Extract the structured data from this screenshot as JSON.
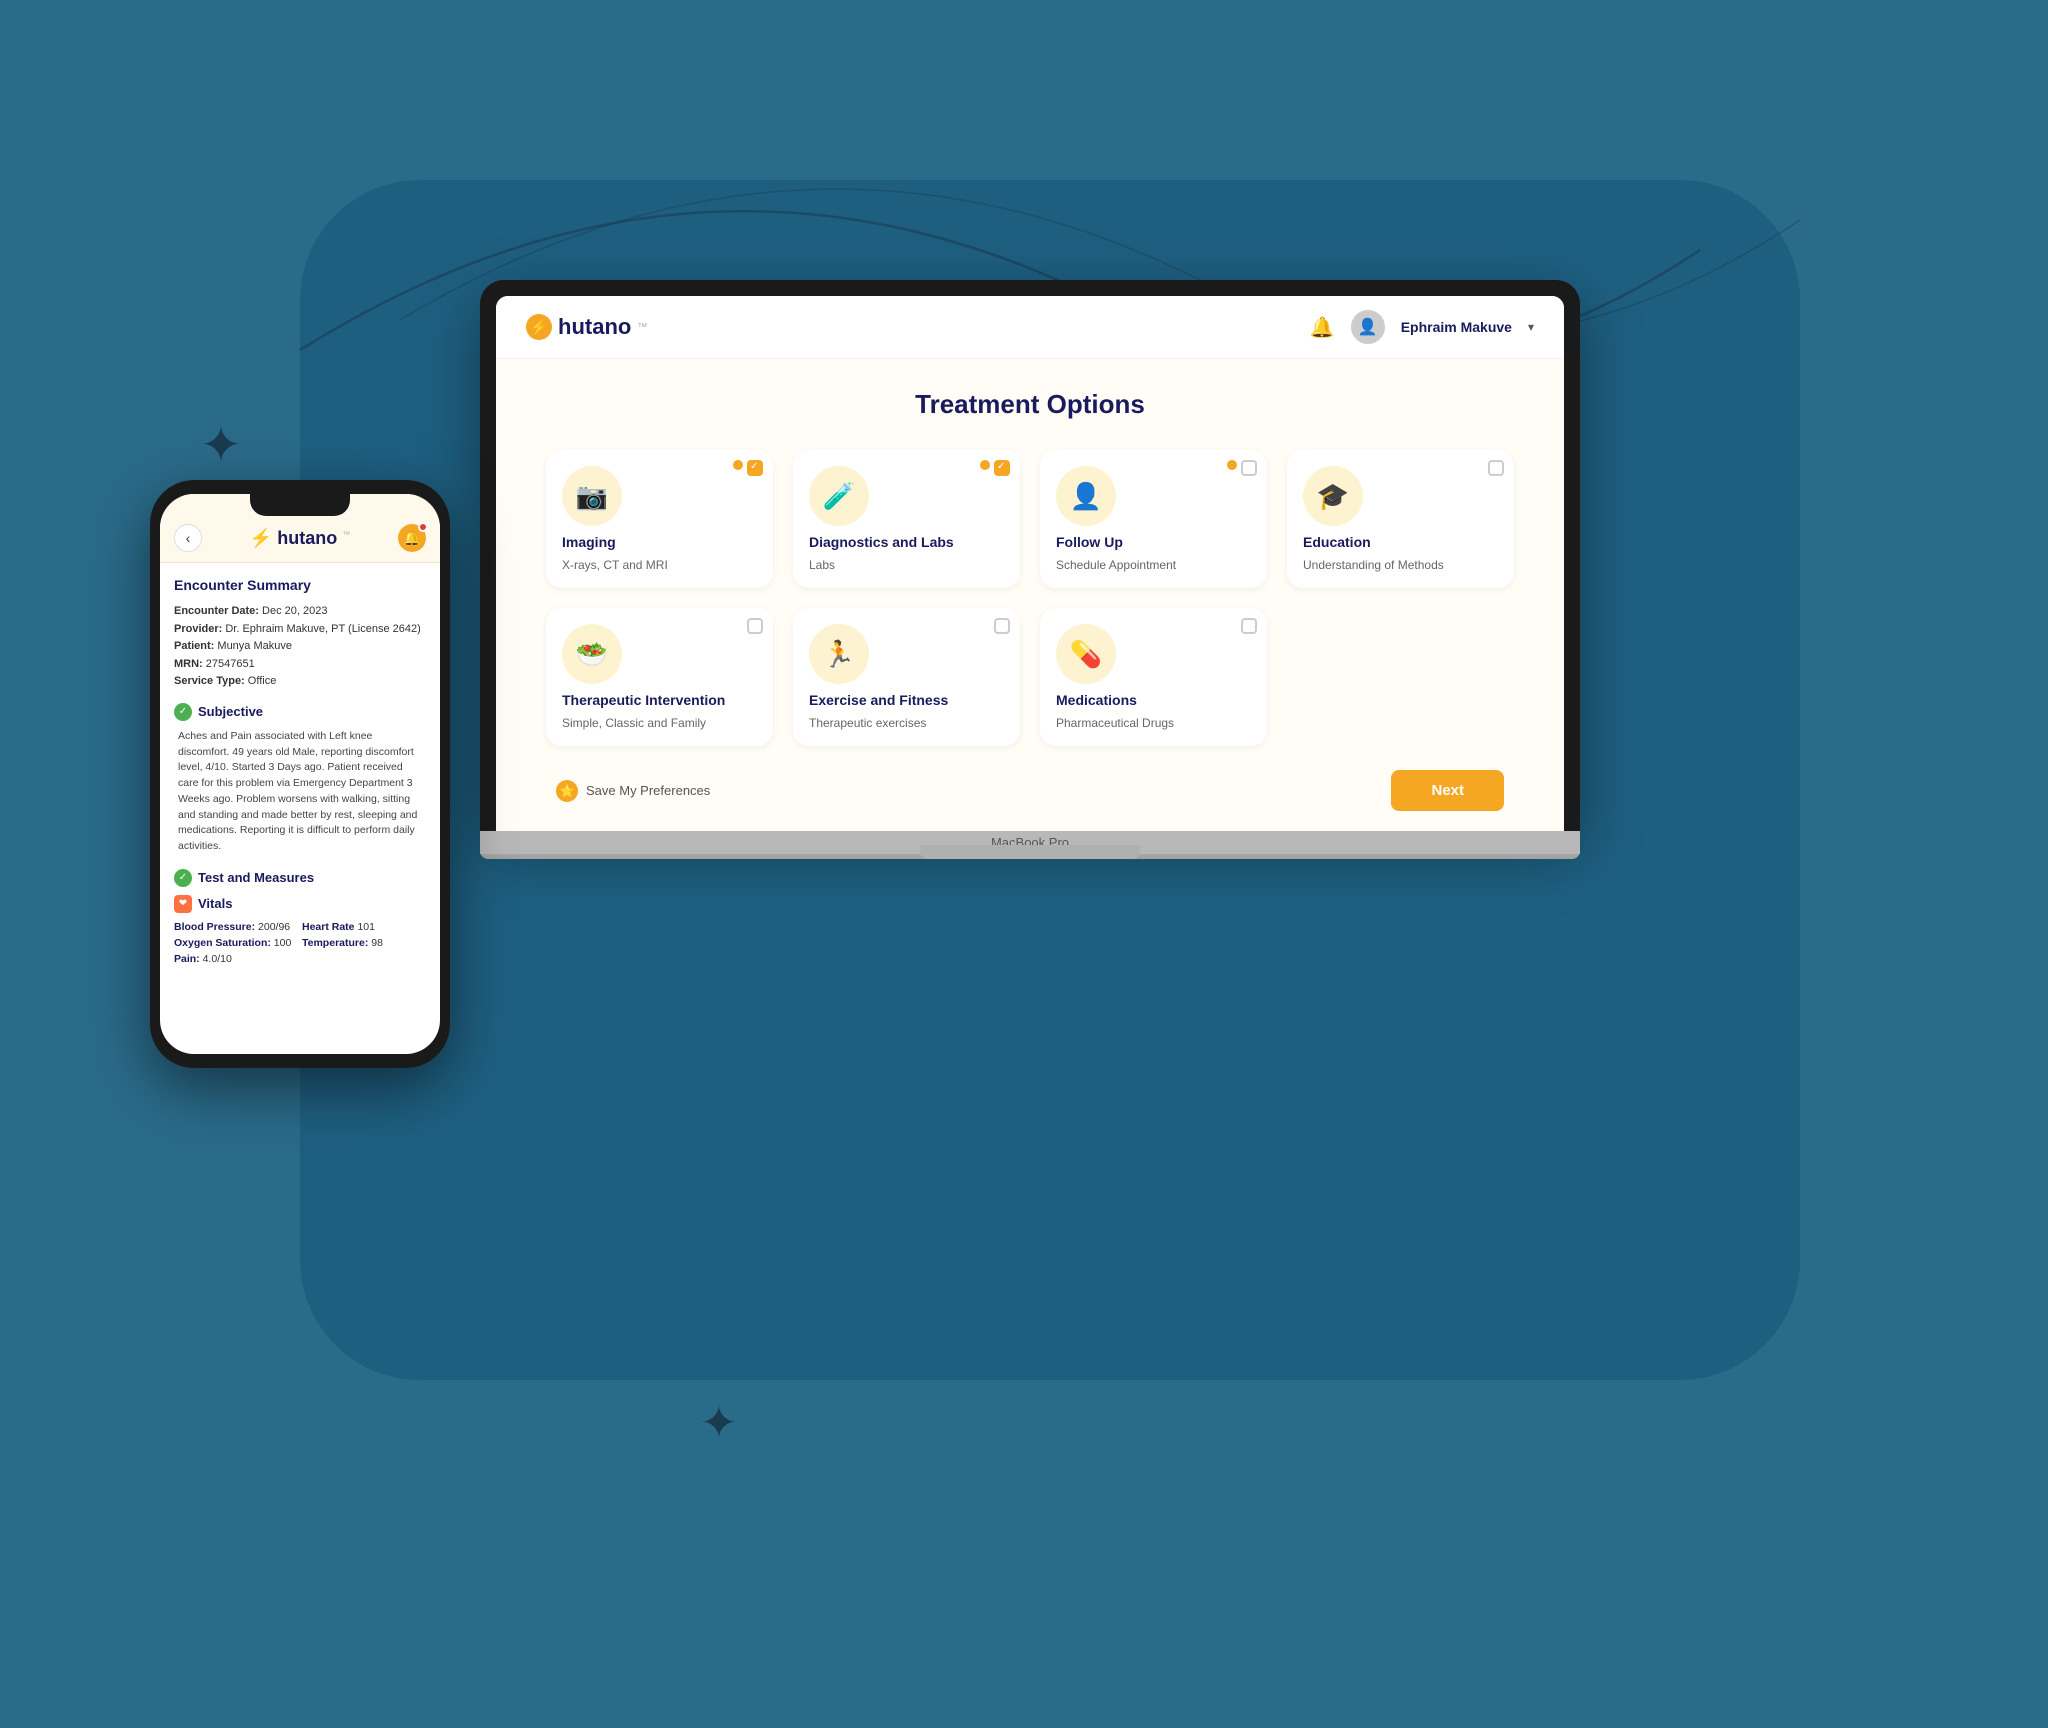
{
  "page": {
    "background_color": "#2a6b8a",
    "blob_color": "#1e5f80"
  },
  "laptop": {
    "model_label": "MacBook Pro",
    "header": {
      "logo_text": "hutano",
      "logo_symbol": "⚡",
      "notification_icon": "🔔",
      "user_name": "Ephraim Makuve",
      "chevron": "▾"
    },
    "content": {
      "title": "Treatment Options",
      "cards": [
        {
          "id": "imaging",
          "icon": "📷",
          "title": "Imaging",
          "subtitle": "X-rays, CT and MRI",
          "checked": true,
          "has_dot": true
        },
        {
          "id": "diagnostics",
          "icon": "🧪",
          "title": "Diagnostics and Labs",
          "subtitle": "Labs",
          "checked": true,
          "has_dot": true
        },
        {
          "id": "followup",
          "icon": "👤",
          "title": "Follow Up",
          "subtitle": "Schedule Appointment",
          "checked": false,
          "has_dot": true
        },
        {
          "id": "education",
          "icon": "🎓",
          "title": "Education",
          "subtitle": "Understanding of Methods",
          "checked": false,
          "has_dot": false
        },
        {
          "id": "therapeutic",
          "icon": "🥗",
          "title": "Therapeutic Intervention",
          "subtitle": "Simple, Classic and Family",
          "checked": false,
          "has_dot": false
        },
        {
          "id": "exercise",
          "icon": "🏃",
          "title": "Exercise and Fitness",
          "subtitle": "Therapeutic exercises",
          "checked": false,
          "has_dot": false
        },
        {
          "id": "medications",
          "icon": "💊",
          "title": "Medications",
          "subtitle": "Pharmaceutical Drugs",
          "checked": false,
          "has_dot": false
        }
      ],
      "save_preferences_label": "Save My Preferences",
      "next_button_label": "Next"
    }
  },
  "phone": {
    "back_icon": "‹",
    "logo_text": "hutano",
    "logo_symbol": "⚡",
    "notification_count": "1",
    "sections": {
      "encounter_summary": {
        "title": "Encounter Summary",
        "encounter_date_label": "Encounter Date:",
        "encounter_date_value": "Dec 20, 2023",
        "provider_label": "Provider:",
        "provider_value": "Dr. Ephraim Makuve, PT (License 2642)",
        "patient_label": "Patient:",
        "patient_value": "Munya Makuve",
        "mrn_label": "MRN:",
        "mrn_value": "27547651",
        "service_label": "Service Type:",
        "service_value": "Office"
      },
      "subjective": {
        "label": "Subjective",
        "narrative": "Aches and Pain associated with Left knee discomfort.\n49 years old Male, reporting discomfort level, 4/10. Started 3 Days ago. Patient received care for this problem via Emergency Department 3 Weeks ago. Problem worsens with walking, sitting and standing and made better by rest, sleeping and medications. Reporting it is difficult to perform daily activities."
      },
      "test_and_measures": {
        "label": "Test and Measures"
      },
      "vitals": {
        "label": "Vitals",
        "blood_pressure_label": "Blood Pressure:",
        "blood_pressure_value": "200/96",
        "heart_rate_label": "Heart Rate",
        "heart_rate_value": "101",
        "oxygen_label": "Oxygen Saturation:",
        "oxygen_value": "100",
        "temperature_label": "Temperature:",
        "temperature_value": "98",
        "pain_label": "Pain:",
        "pain_value": "4.0/10"
      }
    }
  }
}
